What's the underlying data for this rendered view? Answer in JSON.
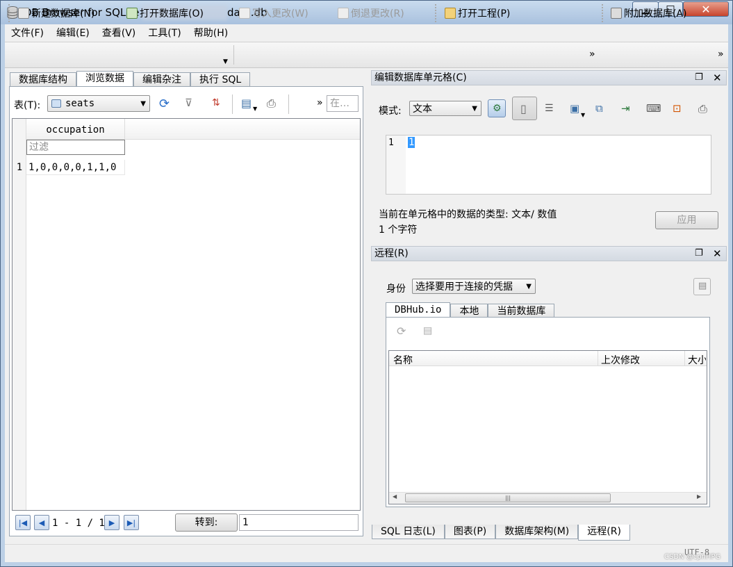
{
  "window": {
    "title_prefix": "DB Browser for SQLite - ",
    "title_suffix": "data.db",
    "minimize": "▁",
    "maximize": "□",
    "close": "✕"
  },
  "menu": [
    "文件(F)",
    "编辑(E)",
    "查看(V)",
    "工具(T)",
    "帮助(H)"
  ],
  "toolbar": {
    "new_db": "新建数据库(N)",
    "open_db": "打开数据库(O)",
    "write_changes": "写入更改(W)",
    "revert_changes": "倒退更改(R)",
    "open_project": "打开工程(P)",
    "attach_db": "附加数据库(A)",
    "overflow": "»"
  },
  "main_tabs": [
    "数据库结构",
    "浏览数据",
    "编辑杂注",
    "执行 SQL"
  ],
  "browse": {
    "table_label": "表(T):",
    "table_value": "seats",
    "filter_more": "»",
    "filter_placeholder": "在…",
    "column": "occupation",
    "filter_text": "过滤",
    "rows": [
      {
        "num": "1",
        "occupation": "1,0,0,0,0,1,1,0"
      }
    ],
    "pager": "1 - 1 / 1",
    "goto_label": "转到:",
    "goto_value": "1"
  },
  "edit_cell": {
    "title": "编辑数据库单元格(C)",
    "mode_label": "模式:",
    "mode_value": "文本",
    "line_number": "1",
    "content": "1",
    "type_text": "当前在单元格中的数据的类型: 文本/ 数值",
    "char_count": "1 个字符",
    "apply": "应用"
  },
  "remote": {
    "title": "远程(R)",
    "identity_label": "身份",
    "identity_value": "选择要用于连接的凭据",
    "tabs": [
      "DBHub.io",
      "本地",
      "当前数据库"
    ],
    "columns": [
      "名称",
      "上次修改",
      "大小"
    ]
  },
  "bottom_tabs": [
    "SQL 日志(L)",
    "图表(P)",
    "数据库架构(M)",
    "远程(R)"
  ],
  "status": {
    "encoding": "UTF-8",
    "watermark": "CSDN @cpnHPG"
  },
  "colors": {
    "accent": "#3399ff",
    "titlebar": "#b9cde6",
    "close": "#c8452d"
  }
}
